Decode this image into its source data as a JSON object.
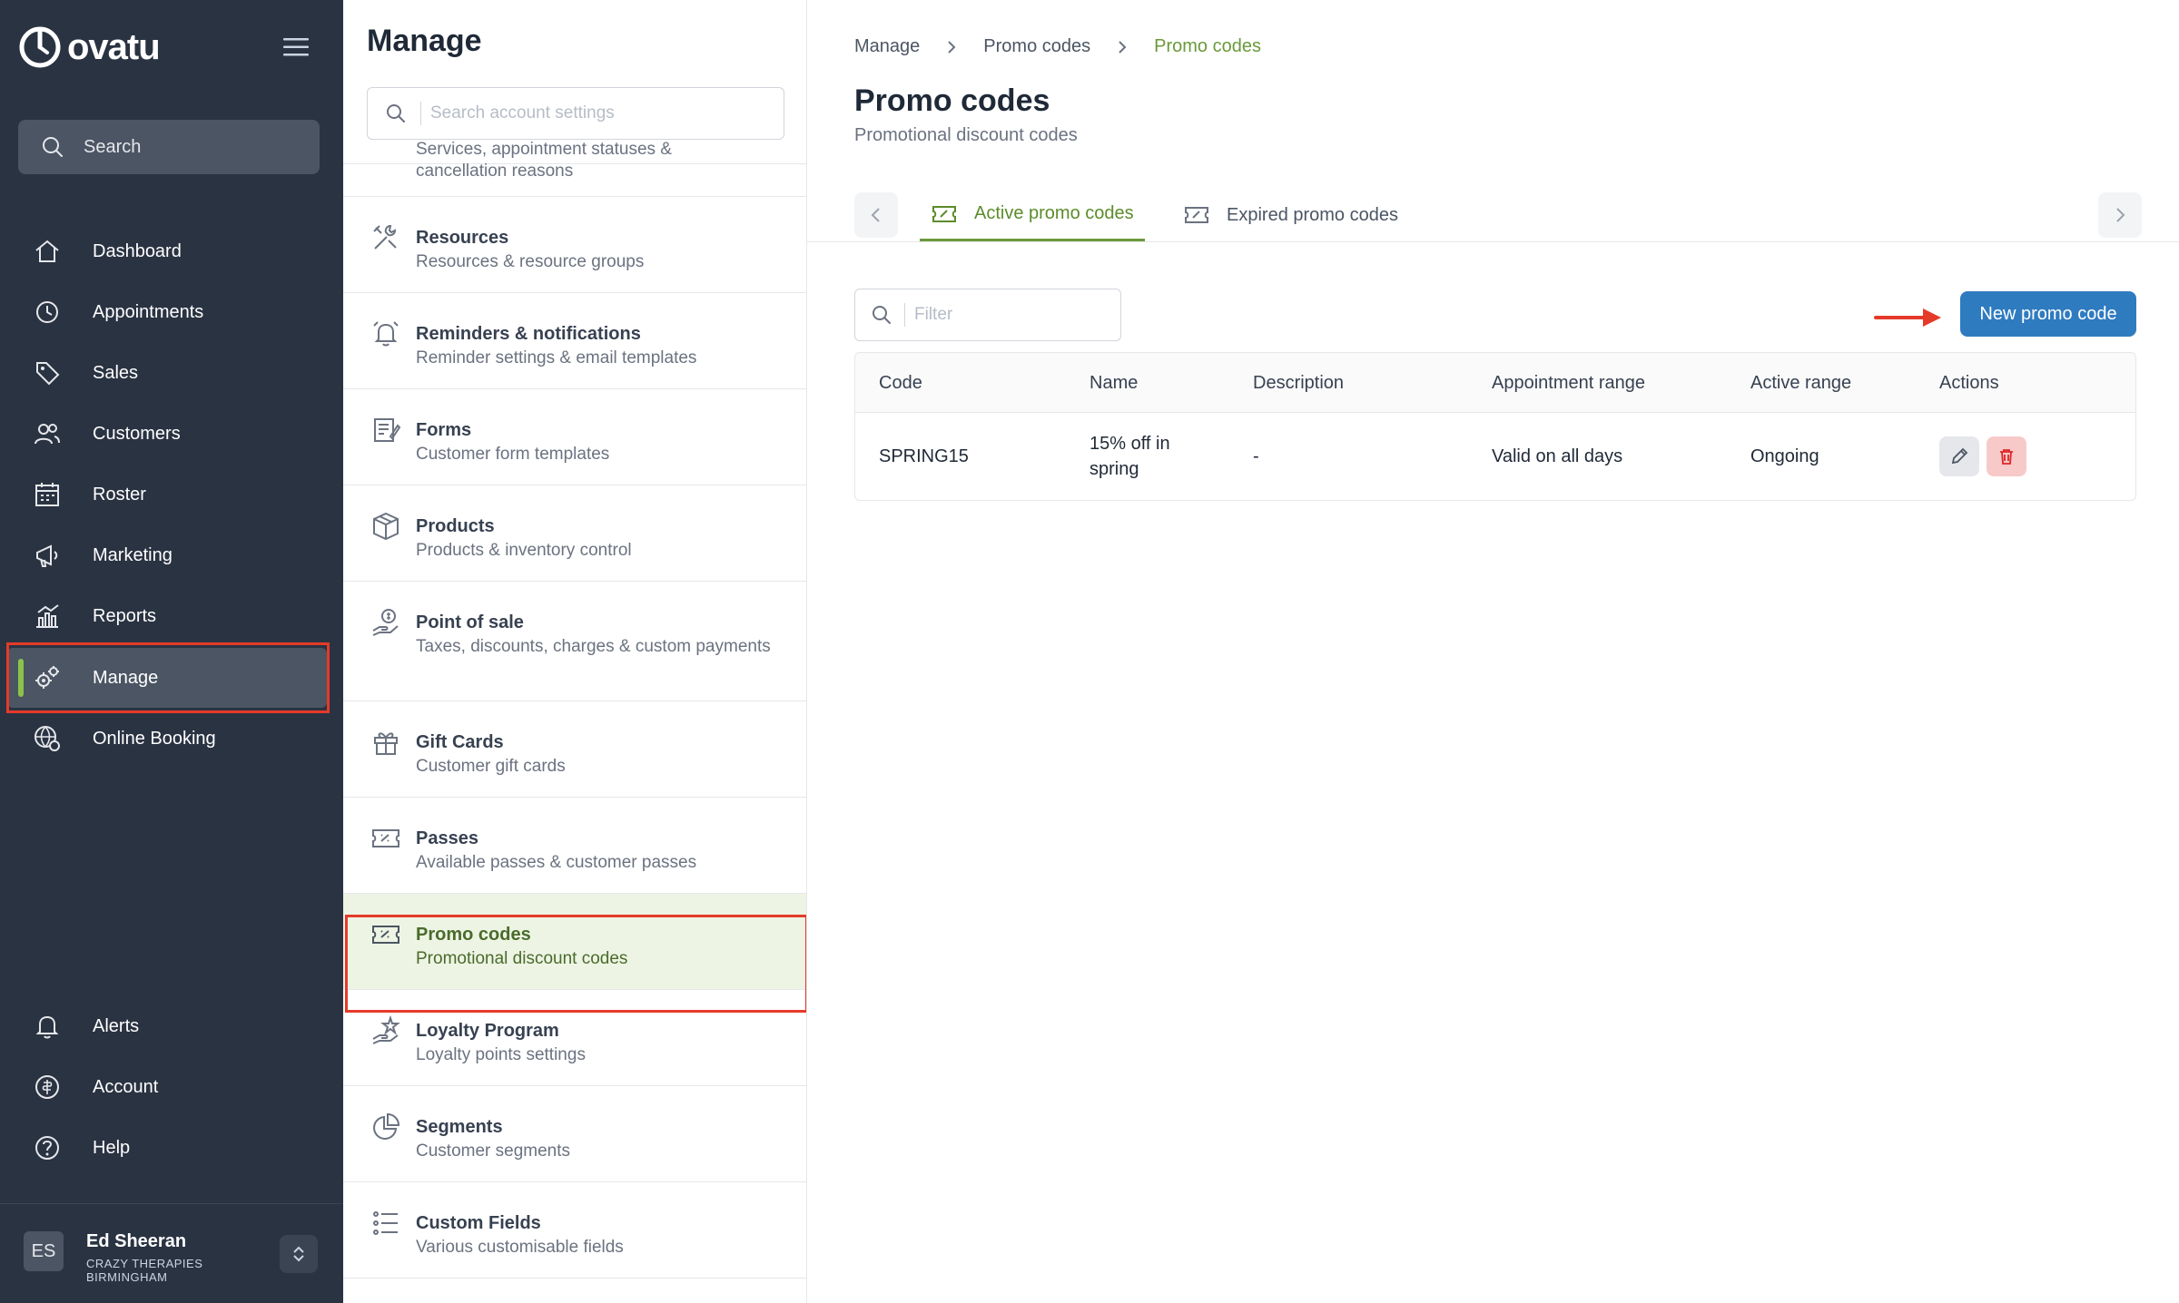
{
  "app": {
    "brand": "ovatu"
  },
  "sidebar": {
    "search_label": "Search",
    "nav": [
      {
        "label": "Dashboard",
        "icon": "home-icon"
      },
      {
        "label": "Appointments",
        "icon": "clock-icon"
      },
      {
        "label": "Sales",
        "icon": "tag-icon"
      },
      {
        "label": "Customers",
        "icon": "users-icon"
      },
      {
        "label": "Roster",
        "icon": "calendar-icon"
      },
      {
        "label": "Marketing",
        "icon": "megaphone-icon"
      },
      {
        "label": "Reports",
        "icon": "chart-icon"
      },
      {
        "label": "Manage",
        "icon": "gears-icon",
        "active": true
      },
      {
        "label": "Online Booking",
        "icon": "globe-gear-icon"
      }
    ],
    "bottom_nav": [
      {
        "label": "Alerts",
        "icon": "bell-icon"
      },
      {
        "label": "Account",
        "icon": "account-icon"
      },
      {
        "label": "Help",
        "icon": "help-icon"
      }
    ],
    "user": {
      "initials": "ES",
      "name": "Ed Sheeran",
      "org_line1": "CRAZY THERAPIES",
      "org_line2": "BIRMINGHAM"
    }
  },
  "manage_panel": {
    "title": "Manage",
    "search_placeholder": "Search account settings",
    "items": [
      {
        "title": "",
        "subtitle": "Services, appointment statuses & cancellation reasons"
      },
      {
        "title": "Resources",
        "subtitle": "Resources & resource groups"
      },
      {
        "title": "Reminders & notifications",
        "subtitle": "Reminder settings & email templates"
      },
      {
        "title": "Forms",
        "subtitle": "Customer form templates"
      },
      {
        "title": "Products",
        "subtitle": "Products & inventory control"
      },
      {
        "title": "Point of sale",
        "subtitle": "Taxes, discounts, charges & custom payments"
      },
      {
        "title": "Gift Cards",
        "subtitle": "Customer gift cards"
      },
      {
        "title": "Passes",
        "subtitle": "Available passes & customer passes"
      },
      {
        "title": "Promo codes",
        "subtitle": "Promotional discount codes",
        "active": true
      },
      {
        "title": "Loyalty Program",
        "subtitle": "Loyalty points settings"
      },
      {
        "title": "Segments",
        "subtitle": "Customer segments"
      },
      {
        "title": "Custom Fields",
        "subtitle": "Various customisable fields"
      }
    ]
  },
  "main": {
    "breadcrumb": [
      "Manage",
      "Promo codes",
      "Promo codes"
    ],
    "title": "Promo codes",
    "subtitle": "Promotional discount codes",
    "tabs": [
      {
        "label": "Active promo codes",
        "active": true
      },
      {
        "label": "Expired promo codes",
        "active": false
      }
    ],
    "filter_placeholder": "Filter",
    "new_button_label": "New promo code",
    "table": {
      "columns": [
        "Code",
        "Name",
        "Description",
        "Appointment range",
        "Active range",
        "Actions"
      ],
      "rows": [
        {
          "code": "SPRING15",
          "name_line1": "15% off in",
          "name_line2": "spring",
          "description": "-",
          "appointment_range": "Valid on all days",
          "active_range": "Ongoing"
        }
      ]
    }
  },
  "colors": {
    "sidebar_bg": "#2a3342",
    "accent_green": "#6a9a3a",
    "primary_blue": "#2f7bc0",
    "highlight_red": "#e53a2a"
  }
}
